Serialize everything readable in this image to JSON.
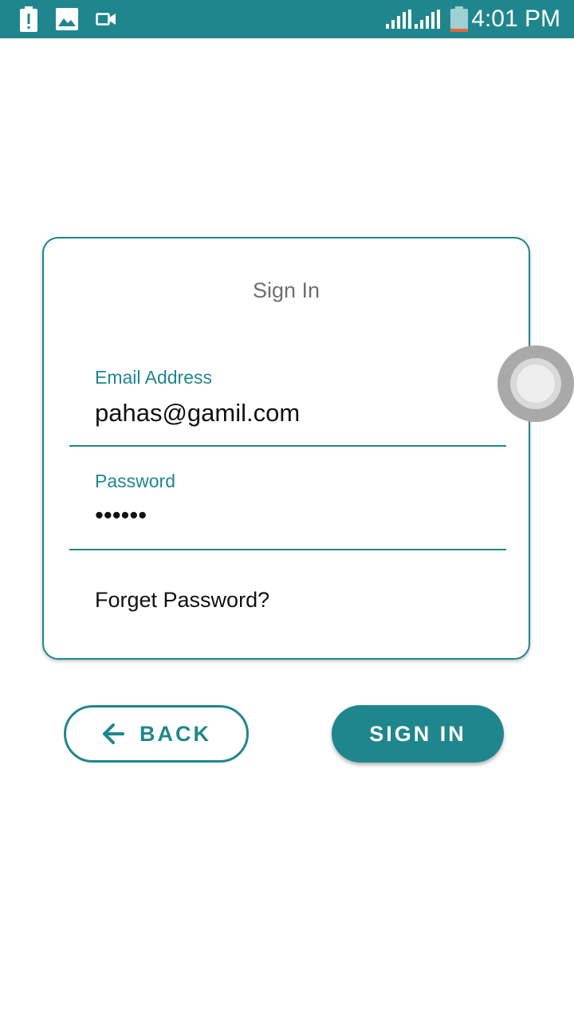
{
  "status_bar": {
    "time": "4:01 PM",
    "icons": [
      "battery-alert-icon",
      "image-icon",
      "video-icon",
      "signal-icon",
      "signal-icon",
      "battery-icon"
    ],
    "background_color": "#20868e"
  },
  "card": {
    "title": "Sign In",
    "email": {
      "label": "Email Address",
      "value": "pahas@gamil.com"
    },
    "password": {
      "label": "Password",
      "value": "••••••"
    },
    "forgot_label": "Forget Password?"
  },
  "buttons": {
    "back_label": "BACK",
    "signin_label": "SIGN IN"
  },
  "colors": {
    "accent": "#20868e",
    "text": "#111111",
    "muted": "#6f6f6f"
  }
}
